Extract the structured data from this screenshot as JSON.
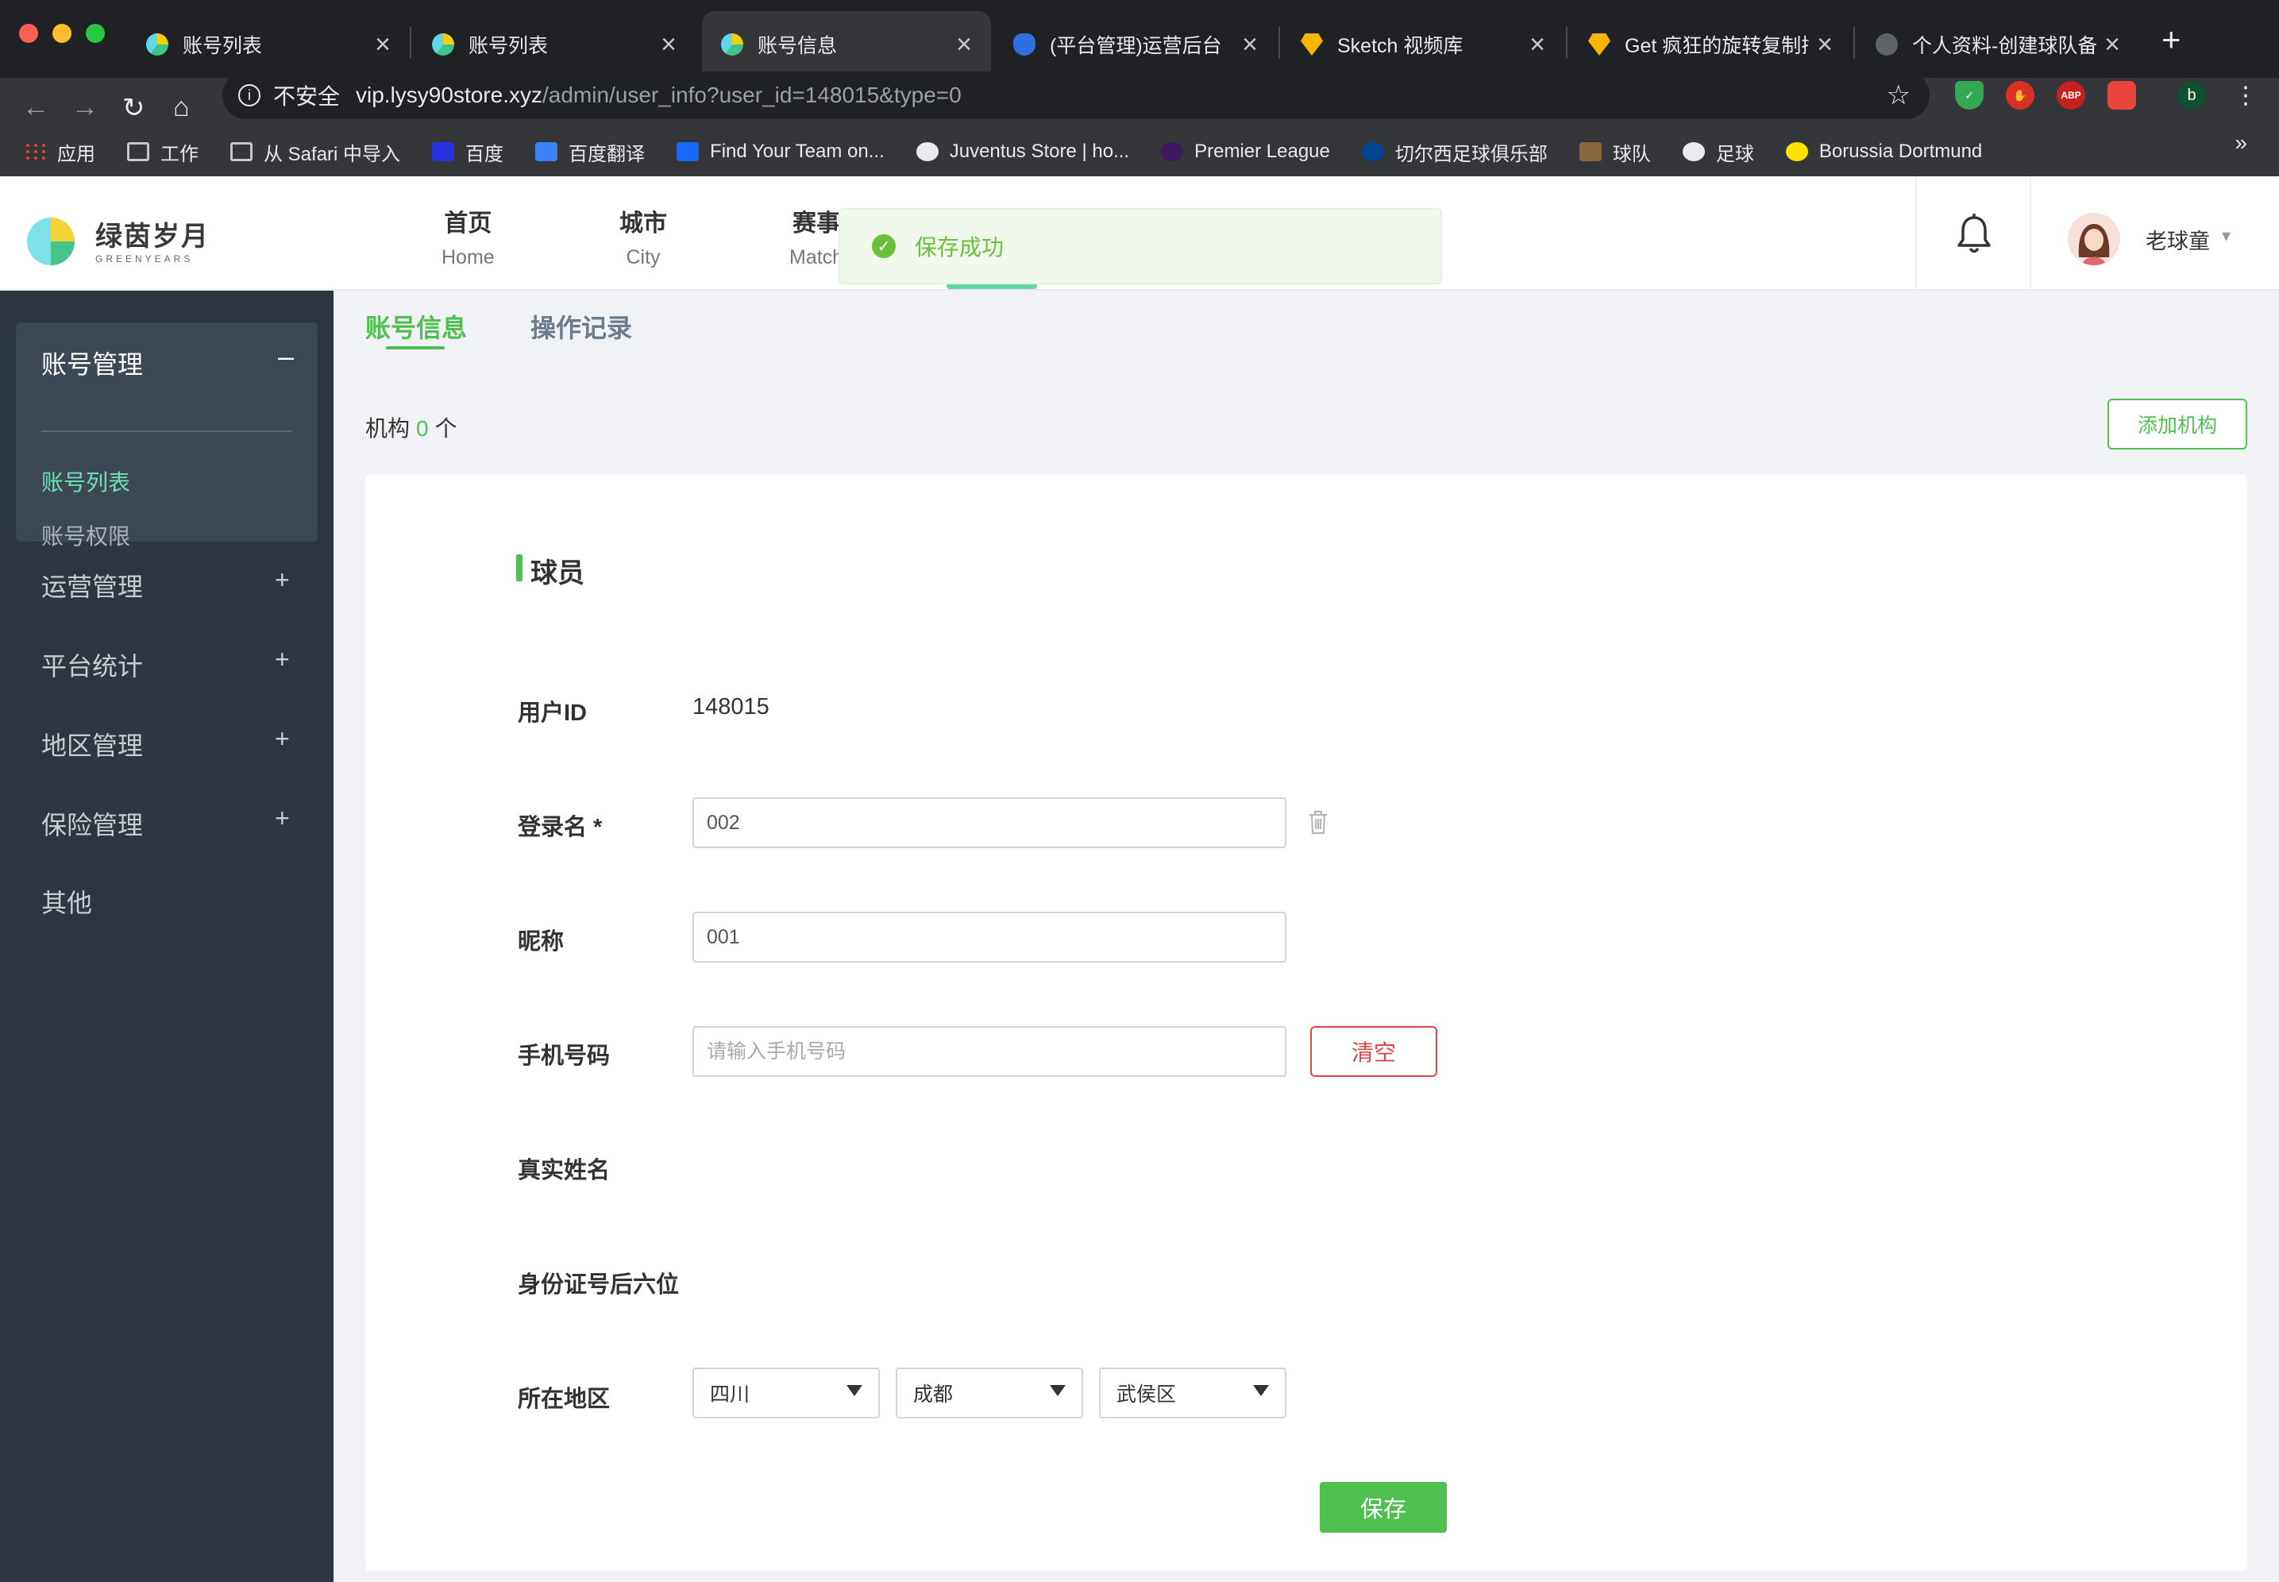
{
  "browser": {
    "tabs": [
      {
        "title": "账号列表",
        "favicon": "app-favicon",
        "active": false
      },
      {
        "title": "账号列表",
        "favicon": "app-favicon",
        "active": false
      },
      {
        "title": "账号信息",
        "favicon": "app-favicon",
        "active": true
      },
      {
        "title": "(平台管理)运营后台",
        "favicon": "blue-bird-favicon",
        "active": false
      },
      {
        "title": "Sketch 视频库",
        "favicon": "sketch-favicon",
        "active": false
      },
      {
        "title": "Get 疯狂的旋转复制插",
        "favicon": "sketch-favicon",
        "active": false
      },
      {
        "title": "个人资料-创建球队备",
        "favicon": "globe-favicon",
        "active": false
      }
    ],
    "address": {
      "security": "不安全",
      "host": "vip.lysy90store.xyz",
      "path": "/admin/user_info?user_id=148015&type=0"
    },
    "profile_letter": "b",
    "ext_abp": "ABP",
    "bookmarks": [
      {
        "label": "应用",
        "icon": "apps-icon"
      },
      {
        "label": "工作",
        "icon": "folder-icon"
      },
      {
        "label": "从 Safari 中导入",
        "icon": "folder-icon"
      },
      {
        "label": "百度",
        "icon": "baidu-icon"
      },
      {
        "label": "百度翻译",
        "icon": "translate-icon"
      },
      {
        "label": "Find Your Team on...",
        "icon": "behance-icon"
      },
      {
        "label": "Juventus Store | ho...",
        "icon": "globe-icon"
      },
      {
        "label": "Premier League",
        "icon": "premier-league-icon"
      },
      {
        "label": "切尔西足球俱乐部",
        "icon": "chelsea-icon"
      },
      {
        "label": "球队",
        "icon": "team-icon"
      },
      {
        "label": "足球",
        "icon": "globe-icon"
      },
      {
        "label": "Borussia Dortmund",
        "icon": "bvb-icon"
      }
    ],
    "bookmarks_more": "»"
  },
  "header": {
    "logo_cn": "绿茵岁月",
    "logo_en": "GREENYEARS",
    "nav": [
      {
        "cn": "首页",
        "en": "Home"
      },
      {
        "cn": "城市",
        "en": "City"
      },
      {
        "cn": "赛事",
        "en": "Match"
      }
    ],
    "username": "老球童"
  },
  "toast": {
    "message": "保存成功"
  },
  "sidebar": {
    "group": {
      "title": "账号管理",
      "toggle": "–",
      "items": [
        {
          "label": "账号列表",
          "active": true
        },
        {
          "label": "账号权限",
          "active": false
        }
      ]
    },
    "items": [
      {
        "label": "运营管理",
        "toggle": "+"
      },
      {
        "label": "平台统计",
        "toggle": "+"
      },
      {
        "label": "地区管理",
        "toggle": "+"
      },
      {
        "label": "保险管理",
        "toggle": "+"
      },
      {
        "label": "其他",
        "toggle": ""
      }
    ]
  },
  "main": {
    "tabs": [
      "账号信息",
      "操作记录"
    ],
    "org_prefix": "机构",
    "org_count": "0",
    "org_suffix": "个",
    "add_org": "添加机构",
    "section_title": "球员",
    "fields": {
      "user_id_label": "用户ID",
      "user_id_value": "148015",
      "login_label": "登录名 *",
      "login_value": "002",
      "nickname_label": "昵称",
      "nickname_value": "001",
      "phone_label": "手机号码",
      "phone_placeholder": "请输入手机号码",
      "clear": "清空",
      "realname_label": "真实姓名",
      "id_label": "身份证号后六位",
      "region_label": "所在地区",
      "province": "四川",
      "city": "成都",
      "district": "武侯区",
      "save": "保存"
    }
  },
  "colors": {
    "accent": "#4fbf4f",
    "danger": "#e04444",
    "sidebar": "#2c3742",
    "toast_bg": "#f0f9eb"
  }
}
